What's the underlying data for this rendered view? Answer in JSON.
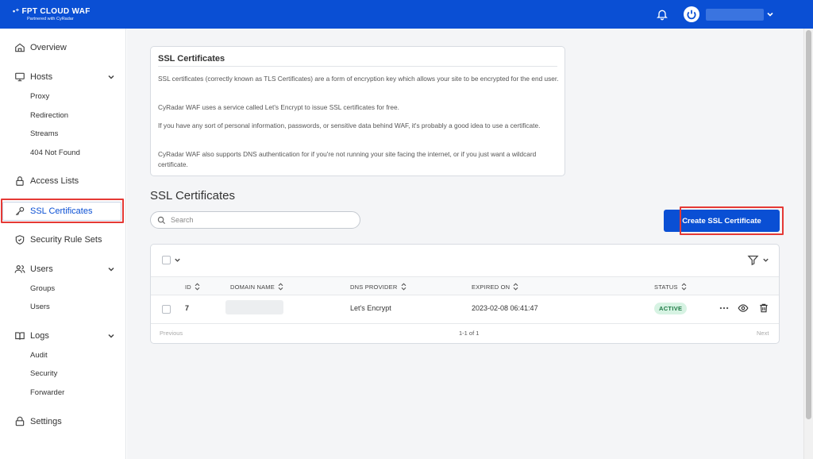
{
  "header": {
    "brand": "FPT CLOUD  WAF",
    "tagline": "Partnered with CyRadar",
    "accent": "#0a4fd4"
  },
  "sidebar": {
    "overview": "Overview",
    "hosts": "Hosts",
    "hosts_sub": [
      "Proxy",
      "Redirection",
      "Streams",
      "404 Not Found"
    ],
    "access_lists": "Access Lists",
    "ssl_certificates": "SSL Certificates",
    "security_rule_sets": "Security Rule Sets",
    "users": "Users",
    "users_sub": [
      "Groups",
      "Users"
    ],
    "logs": "Logs",
    "logs_sub": [
      "Audit",
      "Security",
      "Forwarder"
    ],
    "settings": "Settings"
  },
  "info": {
    "title": "SSL Certificates",
    "p1": "SSL certificates (correctly known as TLS Certificates) are a form of encryption key which allows your site to be encrypted for the end user.",
    "p2": "CyRadar WAF uses a service called Let's Encrypt to issue SSL certificates for free.",
    "p3": "If you have any sort of personal information, passwords, or sensitive data behind WAF, it's probably a good idea to use a certificate.",
    "p4": "CyRadar WAF also supports DNS authentication for if you're not running your site facing the internet, or if you just want a wildcard certificate."
  },
  "main": {
    "title": "SSL Certificates",
    "search_placeholder": "Search",
    "create_button": "Create SSL Certificate"
  },
  "table": {
    "columns": [
      "ID",
      "DOMAIN NAME",
      "DNS PROVIDER",
      "EXPIRED ON",
      "STATUS"
    ],
    "rows": [
      {
        "id": "7",
        "dns_provider": "Let's Encrypt",
        "expired_on": "2023-02-08 06:41:47",
        "status": "ACTIVE"
      }
    ],
    "pager": {
      "prev": "Previous",
      "range": "1-1 of 1",
      "next": "Next"
    }
  }
}
